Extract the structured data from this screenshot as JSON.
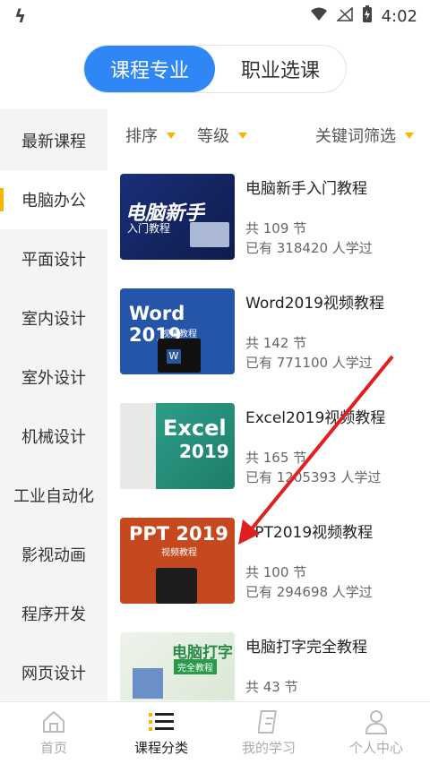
{
  "status_bar": {
    "time": "4:02"
  },
  "segments": [
    {
      "label": "课程专业",
      "active": true
    },
    {
      "label": "职业选课",
      "active": false
    }
  ],
  "sidebar": {
    "items": [
      {
        "label": "最新课程"
      },
      {
        "label": "电脑办公"
      },
      {
        "label": "平面设计"
      },
      {
        "label": "室内设计"
      },
      {
        "label": "室外设计"
      },
      {
        "label": "机械设计"
      },
      {
        "label": "工业自动化"
      },
      {
        "label": "影视动画"
      },
      {
        "label": "程序开发"
      },
      {
        "label": "网页设计"
      }
    ],
    "active_index": 1
  },
  "filters": {
    "sort": "排序",
    "level": "等级",
    "keyword": "关键词筛选"
  },
  "courses": [
    {
      "title": "电脑新手入门教程",
      "lessons": "共 109 节",
      "learners": "已有  318420 人学过",
      "thumb_text": "电脑新手",
      "thumb_sub": "入门教程"
    },
    {
      "title": "Word2019视频教程",
      "lessons": "共 142 节",
      "learners": "已有  771100 人学过",
      "thumb_text": "Word 2019",
      "thumb_sub": "视频教程"
    },
    {
      "title": "Excel2019视频教程",
      "lessons": "共 165 节",
      "learners": "已有  1205393 人学过",
      "thumb_text": "Excel",
      "thumb_sub": "2019"
    },
    {
      "title": "PPT2019视频教程",
      "lessons": "共 100 节",
      "learners": "已有  294698 人学过",
      "thumb_text": "PPT 2019",
      "thumb_sub": "视频教程"
    },
    {
      "title": "电脑打字完全教程",
      "lessons": "共 43 节",
      "learners": "",
      "thumb_text": "电脑打字",
      "thumb_sub": "完全教程"
    }
  ],
  "bottom_nav": [
    {
      "label": "首页",
      "icon": "home-icon",
      "active": false
    },
    {
      "label": "课程分类",
      "icon": "category-list-icon",
      "active": true
    },
    {
      "label": "我的学习",
      "icon": "notebook-icon",
      "active": false
    },
    {
      "label": "个人中心",
      "icon": "person-icon",
      "active": false
    }
  ],
  "colors": {
    "accent_blue": "#2f87f5",
    "accent_yellow": "#f7b500",
    "arrow_red": "#e02020"
  }
}
